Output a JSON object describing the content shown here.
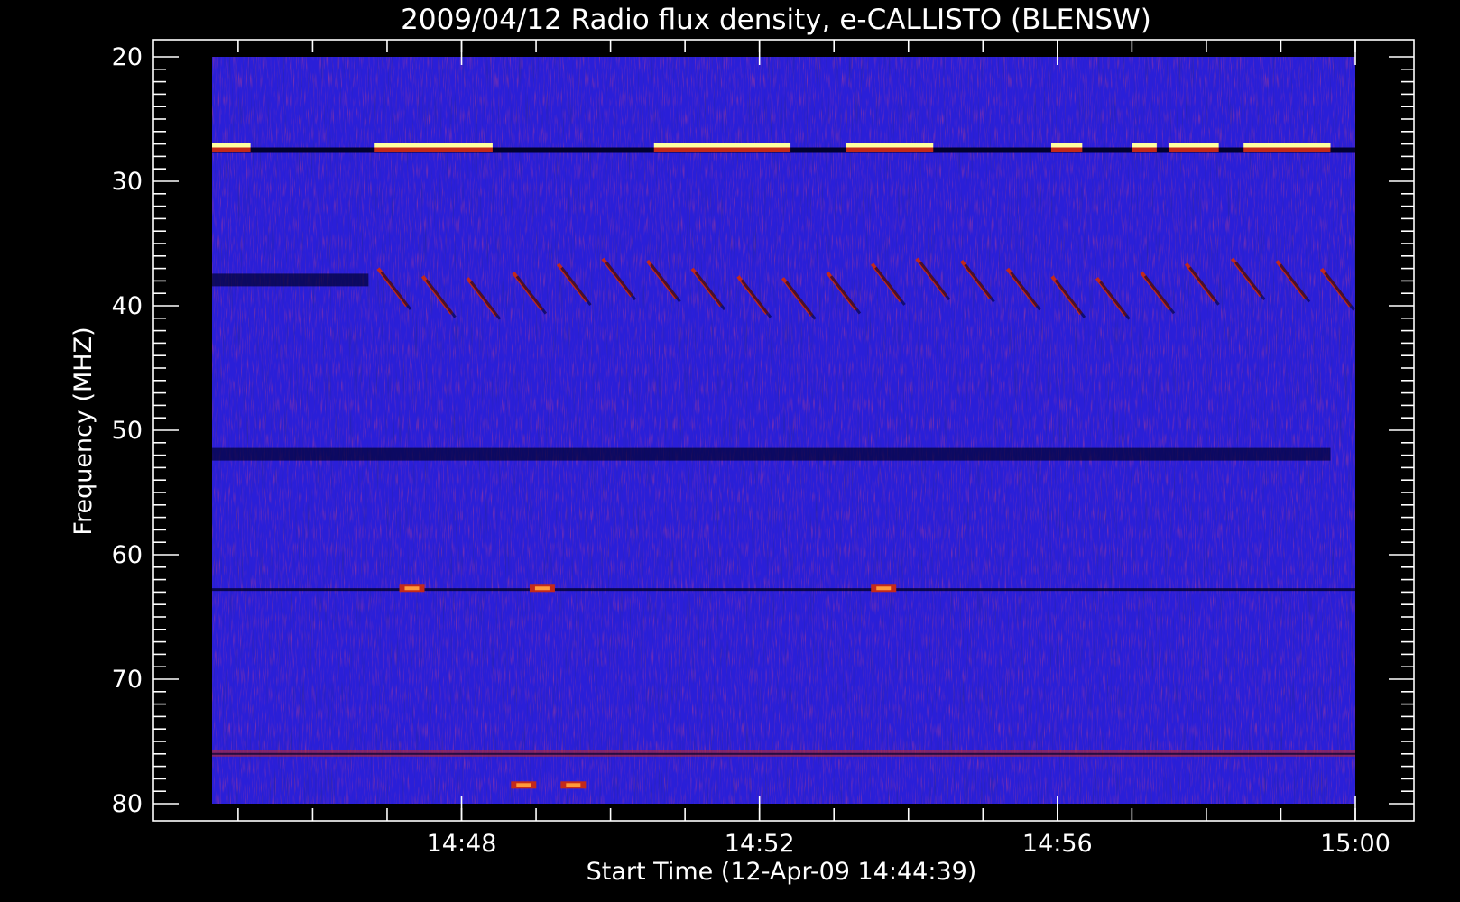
{
  "chart_data": {
    "type": "heatmap",
    "title": "2009/04/12  Radio flux density, e-CALLISTO (BLENSW)",
    "xlabel": "Start Time (12-Apr-09 14:44:39)",
    "ylabel": "Frequency (MHZ)",
    "x_unit": "UT minutes",
    "x_range": [
      "14:44:39",
      "15:00:00"
    ],
    "y_range_mhz": [
      20,
      80
    ],
    "y_reversed": true,
    "y_ticks": [
      "20",
      "30",
      "40",
      "50",
      "60",
      "70",
      "80"
    ],
    "x_ticks": [
      "14:48",
      "14:52",
      "14:56",
      "15:00"
    ],
    "colormap": {
      "background": "#2a1fd8",
      "low": "#000030",
      "mid": "#c42a1a",
      "high": "#ffffa0"
    },
    "features": [
      {
        "kind": "rfi_band",
        "freq_mhz": 27.5,
        "segments": [
          [
            "14:44:39",
            "14:45:10"
          ],
          [
            "14:46:50",
            "14:48:25"
          ],
          [
            "14:50:35",
            "14:52:25"
          ],
          [
            "14:53:10",
            "14:54:20"
          ],
          [
            "14:55:55",
            "14:56:20"
          ],
          [
            "14:57:00",
            "14:57:20"
          ],
          [
            "14:57:30",
            "14:58:10"
          ],
          [
            "14:58:30",
            "14:59:40"
          ]
        ]
      },
      {
        "kind": "dark_band",
        "freq_mhz": 38.0,
        "from": "14:44:39",
        "to": "14:46:45"
      },
      {
        "kind": "type_iii_bursts",
        "freq_from_mhz": 37,
        "freq_to_mhz": 40,
        "from": "14:47:00",
        "to": "14:59:40"
      },
      {
        "kind": "dark_band",
        "freq_mhz": 52.0,
        "from": "14:44:39",
        "to": "14:59:40"
      },
      {
        "kind": "dark_line",
        "freq_mhz": 62.8,
        "from": "14:44:39",
        "to": "15:00:00"
      },
      {
        "kind": "red_spots",
        "freq_mhz": 62.7,
        "times": [
          "14:47:20",
          "14:49:05",
          "14:53:40"
        ]
      },
      {
        "kind": "rfi_band_weak",
        "freq_mhz": 76.0,
        "from": "14:44:39",
        "to": "15:00:00"
      },
      {
        "kind": "red_spots",
        "freq_mhz": 78.5,
        "times": [
          "14:48:50",
          "14:49:30"
        ]
      }
    ]
  }
}
